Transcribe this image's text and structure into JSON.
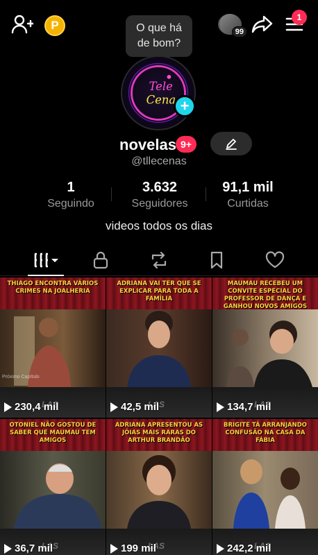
{
  "status_bubble": {
    "text": "O que há de bom?"
  },
  "top_bar": {
    "views_count": "99",
    "menu_badge": "1",
    "coin_letter": "P"
  },
  "avatar": {
    "logo_line1": "Tele",
    "logo_line2": "Cenas"
  },
  "profile": {
    "name": "novelas",
    "name_badge": "9+",
    "handle": "@tllecenas",
    "bio": "videos todos os dias"
  },
  "stats": [
    {
      "value": "1",
      "label": "Seguindo"
    },
    {
      "value": "3.632",
      "label": "Seguidores"
    },
    {
      "value": "91,1 mil",
      "label": "Curtidas"
    }
  ],
  "tabs": [
    "videos-grid",
    "private",
    "reposts",
    "saved",
    "liked"
  ],
  "videos": [
    {
      "caption": "THIAGO ENCONTRA VÁRIOS CRIMES NA JOALHERIA",
      "views": "230,4 mil",
      "overlay": "Próximo Capítulo",
      "watermark": "LAS"
    },
    {
      "caption": "ADRIANA VAI TER QUE SE EXPLICAR PARA TODA A FAMÍLIA",
      "views": "42,5 mil",
      "watermark": "LAS"
    },
    {
      "caption": "MAUMAU RECEBEU UM CONVITE ESPECIAL DO PROFESSOR DE DANÇA E GANHOU NOVOS AMIGOS",
      "views": "134,7 mil",
      "watermark": "LAS"
    },
    {
      "caption": "OTONIEL NÃO GOSTOU DE SABER QUE MAUMAU TEM AMIGOS",
      "views": "36,7 mil",
      "watermark": "LAS"
    },
    {
      "caption": "ADRIANA APRESENTOU AS JÓIAS MAIS RARAS DO ARTHUR BRANDÃO",
      "views": "199 mil",
      "watermark": "LAS"
    },
    {
      "caption": "BRIGITE TÁ ARRANJANDO CONFUSÃO NA CASA DA FÁBIA",
      "views": "242,2 mil",
      "watermark": "LAS"
    }
  ]
}
